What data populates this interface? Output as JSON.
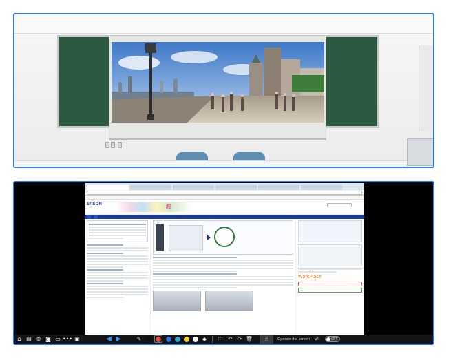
{
  "screen_share": {
    "browser": {
      "tabs": [
        "",
        "",
        "",
        "",
        "",
        ""
      ],
      "url": "",
      "menu": ""
    },
    "site": {
      "logo": "EPSON",
      "header_badge": "約",
      "nav": [
        "",
        ""
      ],
      "right_heading": "WorkPlace"
    }
  },
  "toolbar": {
    "operate_label": "Operate the screen",
    "toggle_label": "OFF",
    "icons": {
      "home": "⌂",
      "layers": "▤",
      "zoom": "⊕",
      "camera": "◙",
      "display": "▭",
      "more": "•••",
      "fullscreen": "▣",
      "back": "◀",
      "forward": "▶",
      "pen": "✎",
      "eraser": "◆",
      "select": "⬚",
      "undo": "↶",
      "redo": "↷",
      "trash": "🗑",
      "hand": "☝",
      "touch": "✍"
    },
    "colors": {
      "black": "#111111",
      "gray": "#7a7a7a",
      "red": "#e34b3a",
      "blue": "#2f6fe0",
      "teal": "#27a7c9",
      "yellow": "#f2d21a",
      "white": "#ffffff"
    }
  }
}
